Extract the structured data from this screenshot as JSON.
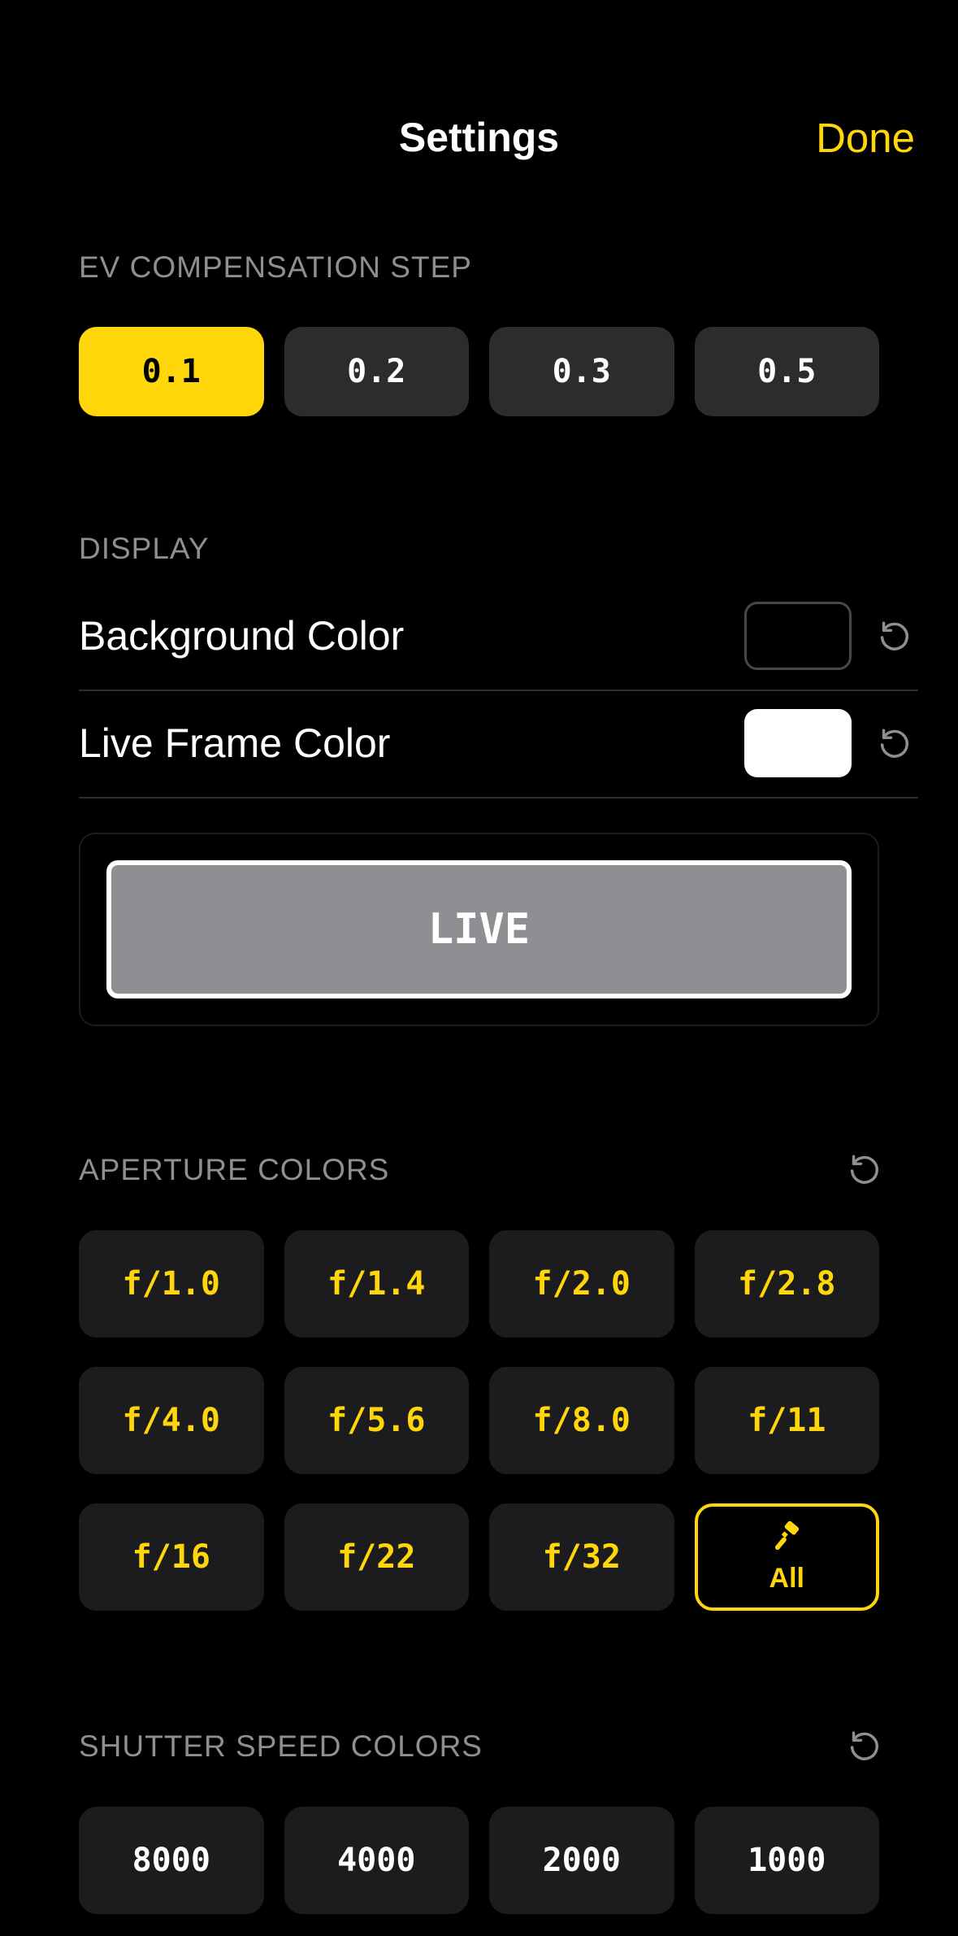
{
  "header": {
    "title": "Settings",
    "done_label": "Done"
  },
  "ev": {
    "section_label": "EV COMPENSATION STEP",
    "steps": [
      "0.1",
      "0.2",
      "0.3",
      "0.5"
    ],
    "selected_index": 0
  },
  "display": {
    "section_label": "DISPLAY",
    "background_color": {
      "label": "Background Color",
      "swatch": "#000000"
    },
    "live_frame_color": {
      "label": "Live Frame Color",
      "swatch": "#FFFFFF"
    },
    "preview_label": "LIVE"
  },
  "aperture": {
    "section_label": "APERTURE COLORS",
    "items": [
      "f/1.0",
      "f/1.4",
      "f/2.0",
      "f/2.8",
      "f/4.0",
      "f/5.6",
      "f/8.0",
      "f/11",
      "f/16",
      "f/22",
      "f/32"
    ],
    "all_label": "All",
    "all_icon": "paintbrush-icon"
  },
  "shutter": {
    "section_label": "SHUTTER SPEED COLORS",
    "items": [
      "8000",
      "4000",
      "2000",
      "1000"
    ]
  },
  "colors": {
    "accent": "#FFD60A",
    "background": "#000000",
    "button_bg": "#2C2C2E",
    "label_gray": "#8E8E93"
  }
}
